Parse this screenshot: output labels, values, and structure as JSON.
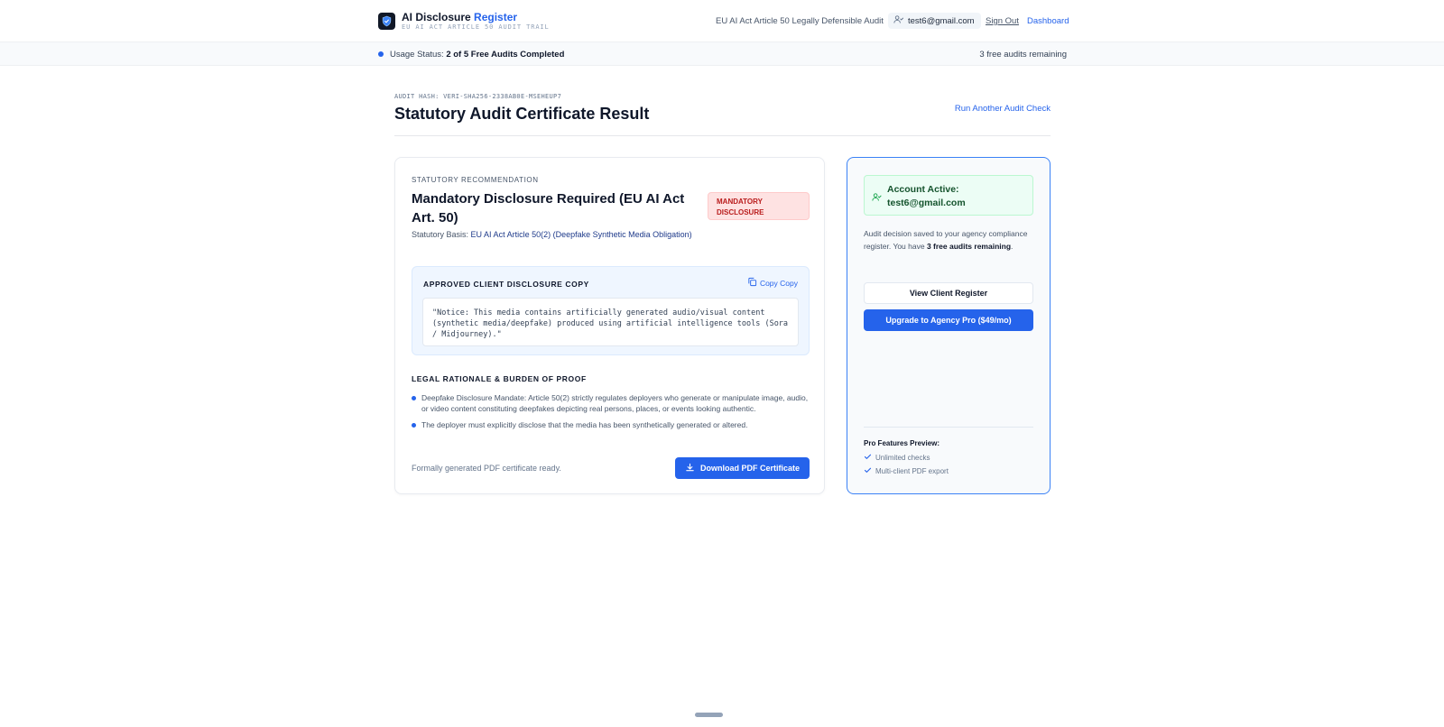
{
  "header": {
    "brand_main": "AI Disclosure",
    "brand_accent": "Register",
    "brand_sub": "EU AI ACT ARTICLE 50 AUDIT TRAIL",
    "claim": "EU AI Act Article 50 Legally Defensible Audit",
    "user_email": "test6@gmail.com",
    "sign_out": "Sign Out",
    "dashboard": "Dashboard"
  },
  "usage": {
    "label": "Usage Status:",
    "value": "2 of 5 Free Audits Completed",
    "remaining": "3 free audits remaining"
  },
  "heading": {
    "hash": "AUDIT HASH: VERI-SHA256-2338AB0E-MSEHEUP7",
    "title": "Statutory Audit Certificate Result",
    "run_another": "Run Another Audit Check"
  },
  "result": {
    "eyebrow": "STATUTORY RECOMMENDATION",
    "verdict": "Mandatory Disclosure Required (EU AI Act Art. 50)",
    "badge_line1": "MANDATORY",
    "badge_line2": "DISCLOSURE",
    "basis_label": "Statutory Basis:",
    "basis_value": "EU AI Act Article 50(2) (Deepfake Synthetic Media Obligation)",
    "copy_heading": "APPROVED CLIENT DISCLOSURE COPY",
    "copy_button": "Copy Copy",
    "copy_text": "\"Notice: This media contains artificially generated audio/visual content (synthetic media/deepfake) produced using artificial intelligence tools (Sora / Midjourney).\"",
    "rationale_heading": "LEGAL RATIONALE & BURDEN OF PROOF",
    "rationale": [
      "Deepfake Disclosure Mandate: Article 50(2) strictly regulates deployers who generate or manipulate image, audio, or video content constituting deepfakes depicting real persons, places, or events looking authentic.",
      "The deployer must explicitly disclose that the media has been synthetically generated or altered."
    ],
    "pdf_note": "Formally generated PDF certificate ready.",
    "pdf_button": "Download PDF Certificate"
  },
  "sidebar": {
    "account_label": "Account Active:",
    "account_email": "test6@gmail.com",
    "desc_part1": "Audit decision saved to your agency compliance register. You have ",
    "desc_bold": "3 free audits remaining",
    "desc_part2": ".",
    "view_register": "View Client Register",
    "upgrade": "Upgrade to Agency Pro ($49/mo)",
    "pro_heading": "Pro Features Preview:",
    "pro_features": [
      "Unlimited checks",
      "Multi-client PDF export"
    ]
  },
  "colors": {
    "accent": "#2563eb",
    "badge_bg": "#fee2e2",
    "badge_text": "#b91c1c",
    "success_bg": "#ecfdf5"
  },
  "icons": [
    "shield-check-icon",
    "user-icon",
    "copy-icon",
    "download-icon",
    "user-check-icon",
    "check-icon"
  ]
}
